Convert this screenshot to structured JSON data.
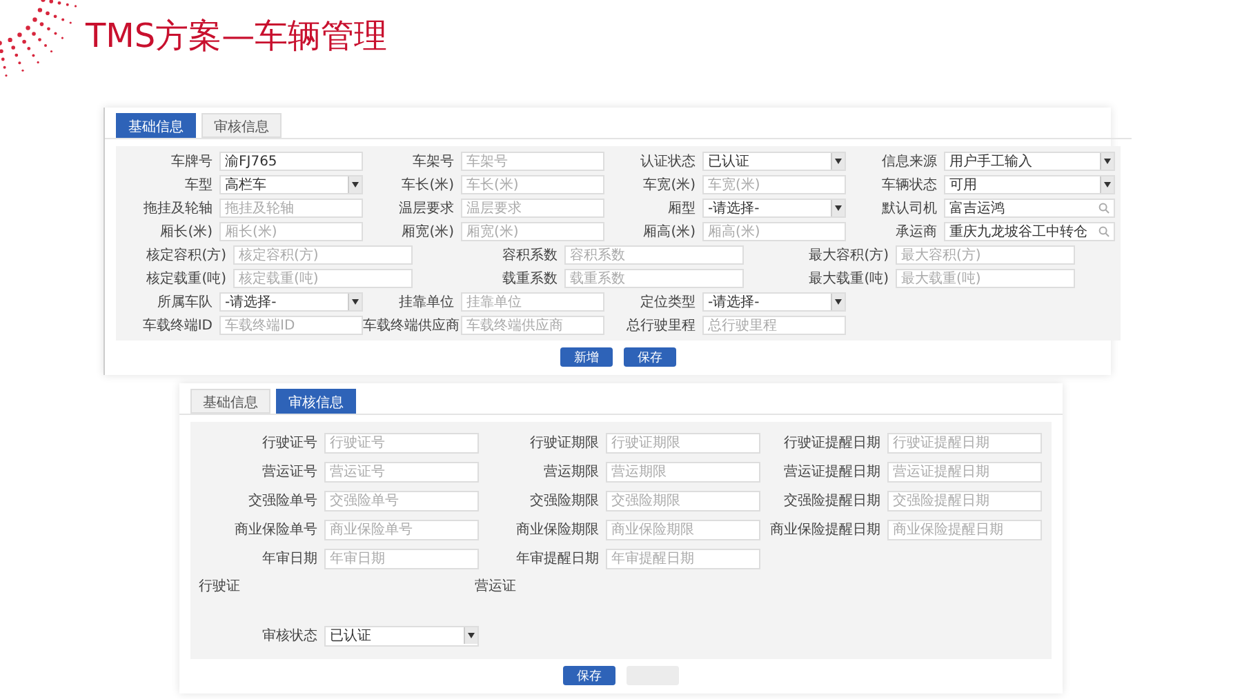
{
  "slide_title": "TMS方案—车辆管理",
  "vehicle_form": {
    "tabs": [
      {
        "label": "基础信息",
        "selected": true
      },
      {
        "label": "审核信息",
        "selected": false
      }
    ],
    "rows": [
      {
        "label": "车牌号",
        "kind": "text",
        "value": "渝FJ765"
      },
      {
        "label": "车架号",
        "kind": "text",
        "placeholder": "车架号"
      },
      {
        "label": "认证状态",
        "kind": "select",
        "value": "已认证"
      },
      {
        "label": "信息来源",
        "kind": "select",
        "value": "用户手工输入"
      },
      {
        "label": "车型",
        "kind": "select",
        "value": "高栏车"
      },
      {
        "label": "车长(米)",
        "kind": "text",
        "placeholder": "车长(米)"
      },
      {
        "label": "车宽(米)",
        "kind": "text",
        "placeholder": "车宽(米)"
      },
      {
        "label": "车辆状态",
        "kind": "select",
        "value": "可用"
      },
      {
        "label": "拖挂及轮轴",
        "kind": "text",
        "placeholder": "拖挂及轮轴"
      },
      {
        "label": "温层要求",
        "kind": "text",
        "placeholder": "温层要求"
      },
      {
        "label": "厢型",
        "kind": "select",
        "value": "-请选择-"
      },
      {
        "label": "默认司机",
        "kind": "search",
        "value": "富吉运鸿"
      },
      {
        "label": "厢长(米)",
        "kind": "text",
        "placeholder": "厢长(米)"
      },
      {
        "label": "厢宽(米)",
        "kind": "text",
        "placeholder": "厢宽(米)"
      },
      {
        "label": "厢高(米)",
        "kind": "text",
        "placeholder": "厢高(米)"
      },
      {
        "label": "承运商",
        "kind": "search",
        "value": "重庆九龙坡谷工中转仓"
      }
    ],
    "capacity_rows": [
      {
        "label": "核定容积(方)",
        "kind": "text",
        "placeholder": "核定容积(方)"
      },
      {
        "label": "容积系数",
        "kind": "text",
        "placeholder": "容积系数"
      },
      {
        "label": "最大容积(方)",
        "kind": "text",
        "placeholder": "最大容积(方)"
      },
      {
        "label": "核定载重(吨)",
        "kind": "text",
        "placeholder": "核定载重(吨)"
      },
      {
        "label": "载重系数",
        "kind": "text",
        "placeholder": "载重系数"
      },
      {
        "label": "最大载重(吨)",
        "kind": "text",
        "placeholder": "最大载重(吨)"
      }
    ],
    "more_rows": [
      {
        "label": "所属车队",
        "kind": "select",
        "value": "-请选择-"
      },
      {
        "label": "挂靠单位",
        "kind": "text",
        "placeholder": "挂靠单位"
      },
      {
        "label": "定位类型",
        "kind": "select",
        "value": "-请选择-"
      },
      {
        "label": "",
        "kind": "empty"
      },
      {
        "label": "车载终端ID",
        "kind": "text",
        "placeholder": "车载终端ID"
      },
      {
        "label": "车载终端供应商",
        "kind": "text",
        "placeholder": "车载终端供应商"
      },
      {
        "label": "总行驶里程",
        "kind": "text",
        "placeholder": "总行驶里程"
      }
    ],
    "buttons": [
      {
        "label": "新增",
        "disabled": false
      },
      {
        "label": "保存",
        "disabled": false
      }
    ]
  },
  "audit_form": {
    "tabs": [
      {
        "label": "基础信息",
        "selected": false
      },
      {
        "label": "审核信息",
        "selected": true
      }
    ],
    "rows": [
      {
        "label": "行驶证号",
        "kind": "text",
        "placeholder": "行驶证号"
      },
      {
        "label": "行驶证期限",
        "kind": "text",
        "placeholder": "行驶证期限"
      },
      {
        "label": "行驶证提醒日期",
        "kind": "text",
        "placeholder": "行驶证提醒日期"
      },
      {
        "label": "营运证号",
        "kind": "text",
        "placeholder": "营运证号"
      },
      {
        "label": "营运期限",
        "kind": "text",
        "placeholder": "营运期限"
      },
      {
        "label": "营运证提醒日期",
        "kind": "text",
        "placeholder": "营运证提醒日期"
      },
      {
        "label": "交强险单号",
        "kind": "text",
        "placeholder": "交强险单号"
      },
      {
        "label": "交强险期限",
        "kind": "text",
        "placeholder": "交强险期限"
      },
      {
        "label": "交强险提醒日期",
        "kind": "text",
        "placeholder": "交强险提醒日期"
      },
      {
        "label": "商业保险单号",
        "kind": "text",
        "placeholder": "商业保险单号"
      },
      {
        "label": "商业保险期限",
        "kind": "text",
        "placeholder": "商业保险期限"
      },
      {
        "label": "商业保险提醒日期",
        "kind": "text",
        "placeholder": "商业保险提醒日期"
      },
      {
        "label": "年审日期",
        "kind": "text",
        "placeholder": "年审日期"
      },
      {
        "label": "年审提醒日期",
        "kind": "text",
        "placeholder": "年审提醒日期"
      }
    ],
    "section_labels": [
      "行驶证",
      "营运证"
    ],
    "status": {
      "label": "审核状态",
      "kind": "select",
      "value": "已认证"
    },
    "buttons": [
      {
        "label": "保存",
        "disabled": false
      },
      {
        "disabled": true
      }
    ]
  }
}
